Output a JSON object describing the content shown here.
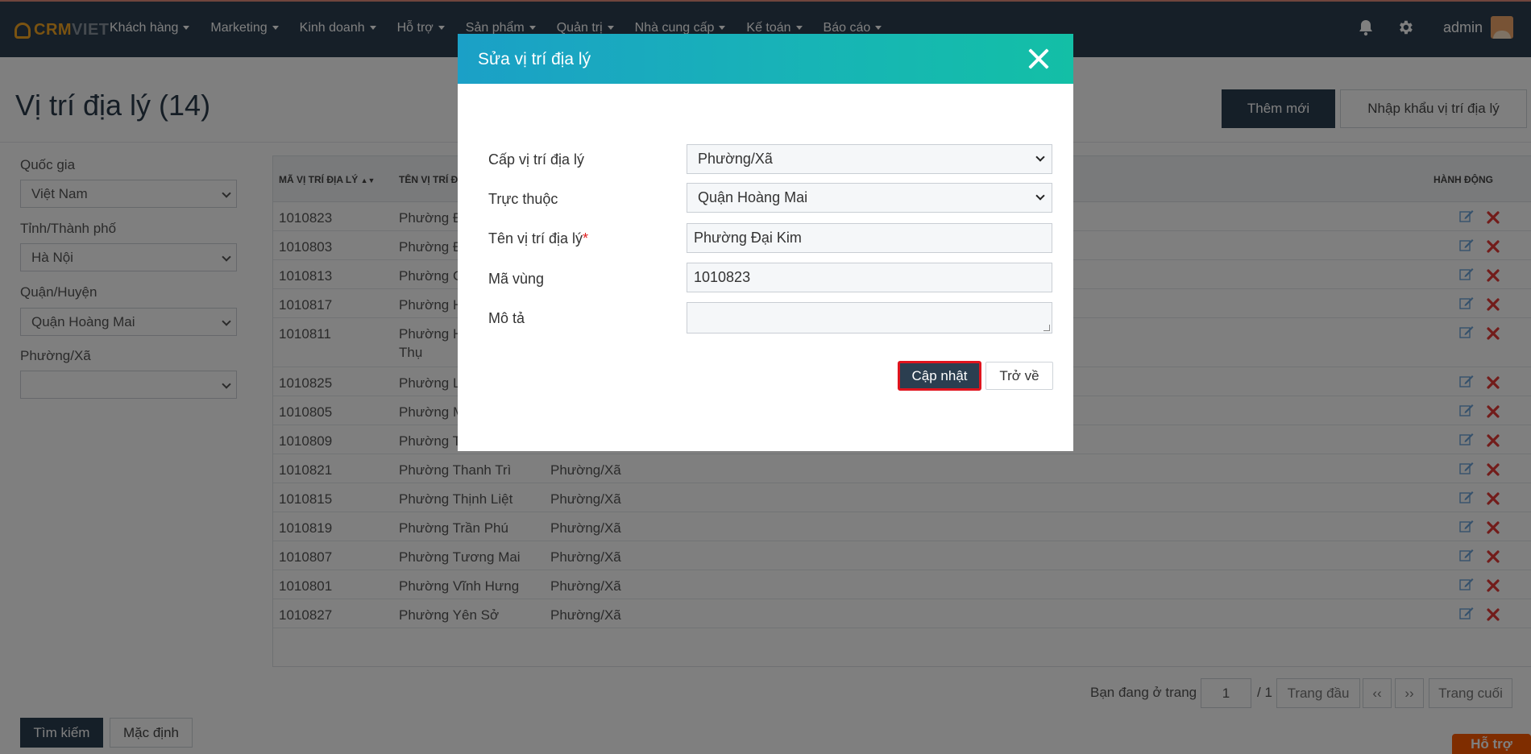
{
  "app": {
    "logo_part1": "CRM",
    "logo_part2": "VIET"
  },
  "nav": {
    "items": [
      {
        "label": "Khách hàng"
      },
      {
        "label": "Marketing"
      },
      {
        "label": "Kinh doanh"
      },
      {
        "label": "Hỗ trợ"
      },
      {
        "label": "Sản phẩm"
      },
      {
        "label": "Quản trị"
      },
      {
        "label": "Nhà cung cấp"
      },
      {
        "label": "Kế toán"
      },
      {
        "label": "Báo cáo"
      }
    ],
    "user_name": "admin"
  },
  "page": {
    "title": "Vị trí địa lý (14)",
    "add_button": "Thêm mới",
    "import_button": "Nhập khẩu vị trí địa lý"
  },
  "filters": {
    "country_label": "Quốc gia",
    "country_value": "Việt Nam",
    "city_label": "Tỉnh/Thành phố",
    "city_value": "Hà Nội",
    "district_label": "Quận/Huyện",
    "district_value": "Quận Hoàng Mai",
    "ward_label": "Phường/Xã",
    "ward_value": "",
    "search_button": "Tìm kiếm",
    "default_button": "Mặc định"
  },
  "table": {
    "headers": {
      "code": "MÃ VỊ TRÍ ĐỊA LÝ",
      "name": "TÊN VỊ TRÍ Đ",
      "actions": "HÀNH ĐỘNG"
    },
    "rows": [
      {
        "code": "1010823",
        "name": "Phường Đ",
        "level": ""
      },
      {
        "code": "1010803",
        "name": "Phường Đ",
        "level": ""
      },
      {
        "code": "1010813",
        "name": "Phường G",
        "level": ""
      },
      {
        "code": "1010817",
        "name": "Phường H",
        "level": ""
      },
      {
        "code": "1010811",
        "name": "Phường H",
        "name2": "Thụ",
        "level": ""
      },
      {
        "code": "1010825",
        "name": "Phường L",
        "level": ""
      },
      {
        "code": "1010805",
        "name": "Phường M",
        "level": ""
      },
      {
        "code": "1010809",
        "name": "Phường T",
        "level": ""
      },
      {
        "code": "1010821",
        "name": "Phường Thanh Trì",
        "level": "Phường/Xã"
      },
      {
        "code": "1010815",
        "name": "Phường Thịnh Liệt",
        "level": "Phường/Xã"
      },
      {
        "code": "1010819",
        "name": "Phường Trần Phú",
        "level": "Phường/Xã"
      },
      {
        "code": "1010807",
        "name": "Phường Tương Mai",
        "level": "Phường/Xã"
      },
      {
        "code": "1010801",
        "name": "Phường Vĩnh Hưng",
        "level": "Phường/Xã"
      },
      {
        "code": "1010827",
        "name": "Phường Yên Sở",
        "level": "Phường/Xã"
      }
    ]
  },
  "pager": {
    "prefix": "Bạn đang ở trang",
    "current": "1",
    "total": "/ 1",
    "first": "Trang đầu",
    "prev": "‹‹",
    "next": "››",
    "last": "Trang cuối"
  },
  "support_button": "Hỗ trợ",
  "modal": {
    "title": "Sửa vị trí địa lý",
    "level_label": "Cấp vị trí địa lý",
    "level_value": "Phường/Xã",
    "parent_label": "Trực thuộc",
    "parent_value": "Quận Hoàng Mai",
    "name_label": "Tên vị trí địa lý",
    "name_required": "*",
    "name_value": "Phường Đại Kim",
    "region_label": "Mã vùng",
    "region_value": "1010823",
    "desc_label": "Mô tả",
    "desc_value": "",
    "update_button": "Cập nhật",
    "back_button": "Trở về"
  },
  "colors": {
    "navbar": "#2d3e50",
    "primary_button": "#2b3e50",
    "delete_icon": "#e53935",
    "modal_header_start": "#1ba0c7",
    "modal_header_end": "#13bfa6",
    "support": "#ff5a00",
    "highlight_border": "#e0141e"
  }
}
